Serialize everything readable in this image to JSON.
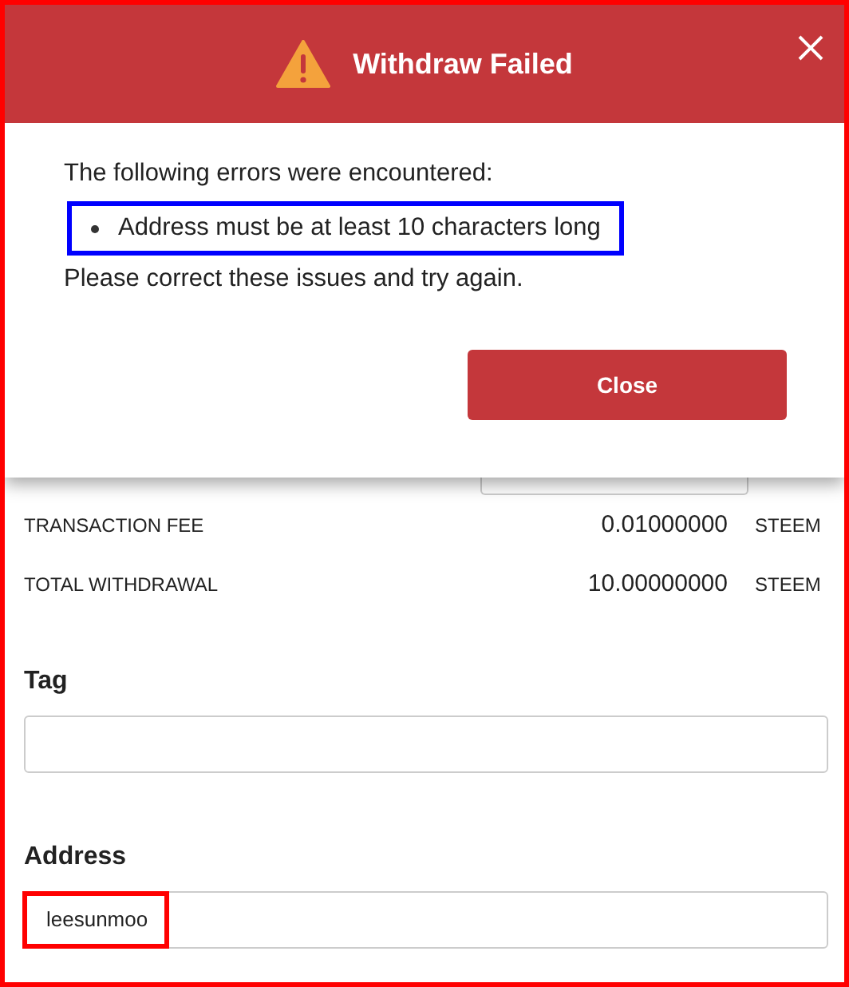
{
  "dialog": {
    "title": "Withdraw Failed",
    "intro": "The following errors were encountered:",
    "errors": [
      {
        "text": "Address must be at least 10 characters long",
        "highlighted": true
      }
    ],
    "outro": "Please correct these issues and try again.",
    "close_button": "Close"
  },
  "summary": [
    {
      "label": "TRANSACTION FEE",
      "amount": "0.01000000",
      "currency": "STEEM"
    },
    {
      "label": "TOTAL WITHDRAWAL",
      "amount": "10.00000000",
      "currency": "STEEM"
    }
  ],
  "fields": [
    {
      "label": "Tag",
      "highlighted": false
    },
    {
      "label": "Address",
      "value": "leesunmoo",
      "highlighted": true
    }
  ]
}
